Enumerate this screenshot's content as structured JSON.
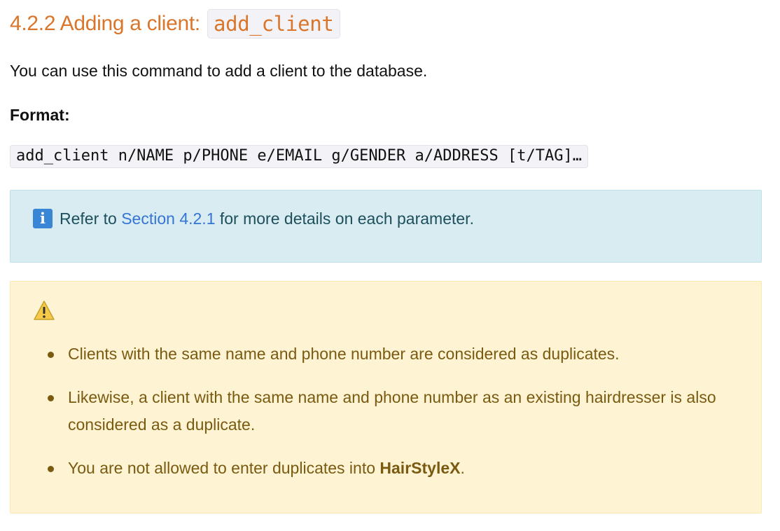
{
  "section": {
    "heading_prefix": "4.2.2 Adding a client:",
    "heading_code": "add_client",
    "intro": "You can use this command to add a client to the database.",
    "format_label": "Format:",
    "format_code": "add_client n/NAME p/PHONE e/EMAIL g/GENDER a/ADDRESS [t/TAG]…"
  },
  "info_box": {
    "icon": "info-icon",
    "text_before": "Refer to",
    "link_text": "Section 4.2.1",
    "text_after": "for more details on each parameter.",
    "bg_color": "#d9ecf1",
    "text_color": "#1d4f5c",
    "link_color": "#3575d4"
  },
  "warning_box": {
    "icon": "warning-icon",
    "bg_color": "#fef4d4",
    "text_color": "#7a5a10",
    "items": [
      {
        "text": "Clients with the same name and phone number are considered as duplicates."
      },
      {
        "text": "Likewise, a client with the same name and phone number as an existing hairdresser is also considered as a duplicate."
      },
      {
        "text_before": "You are not allowed to enter duplicates into",
        "bold": "HairStyleX",
        "text_after": "."
      }
    ]
  },
  "colors": {
    "heading": "#d9762b",
    "code_background": "#f3f3f7"
  }
}
